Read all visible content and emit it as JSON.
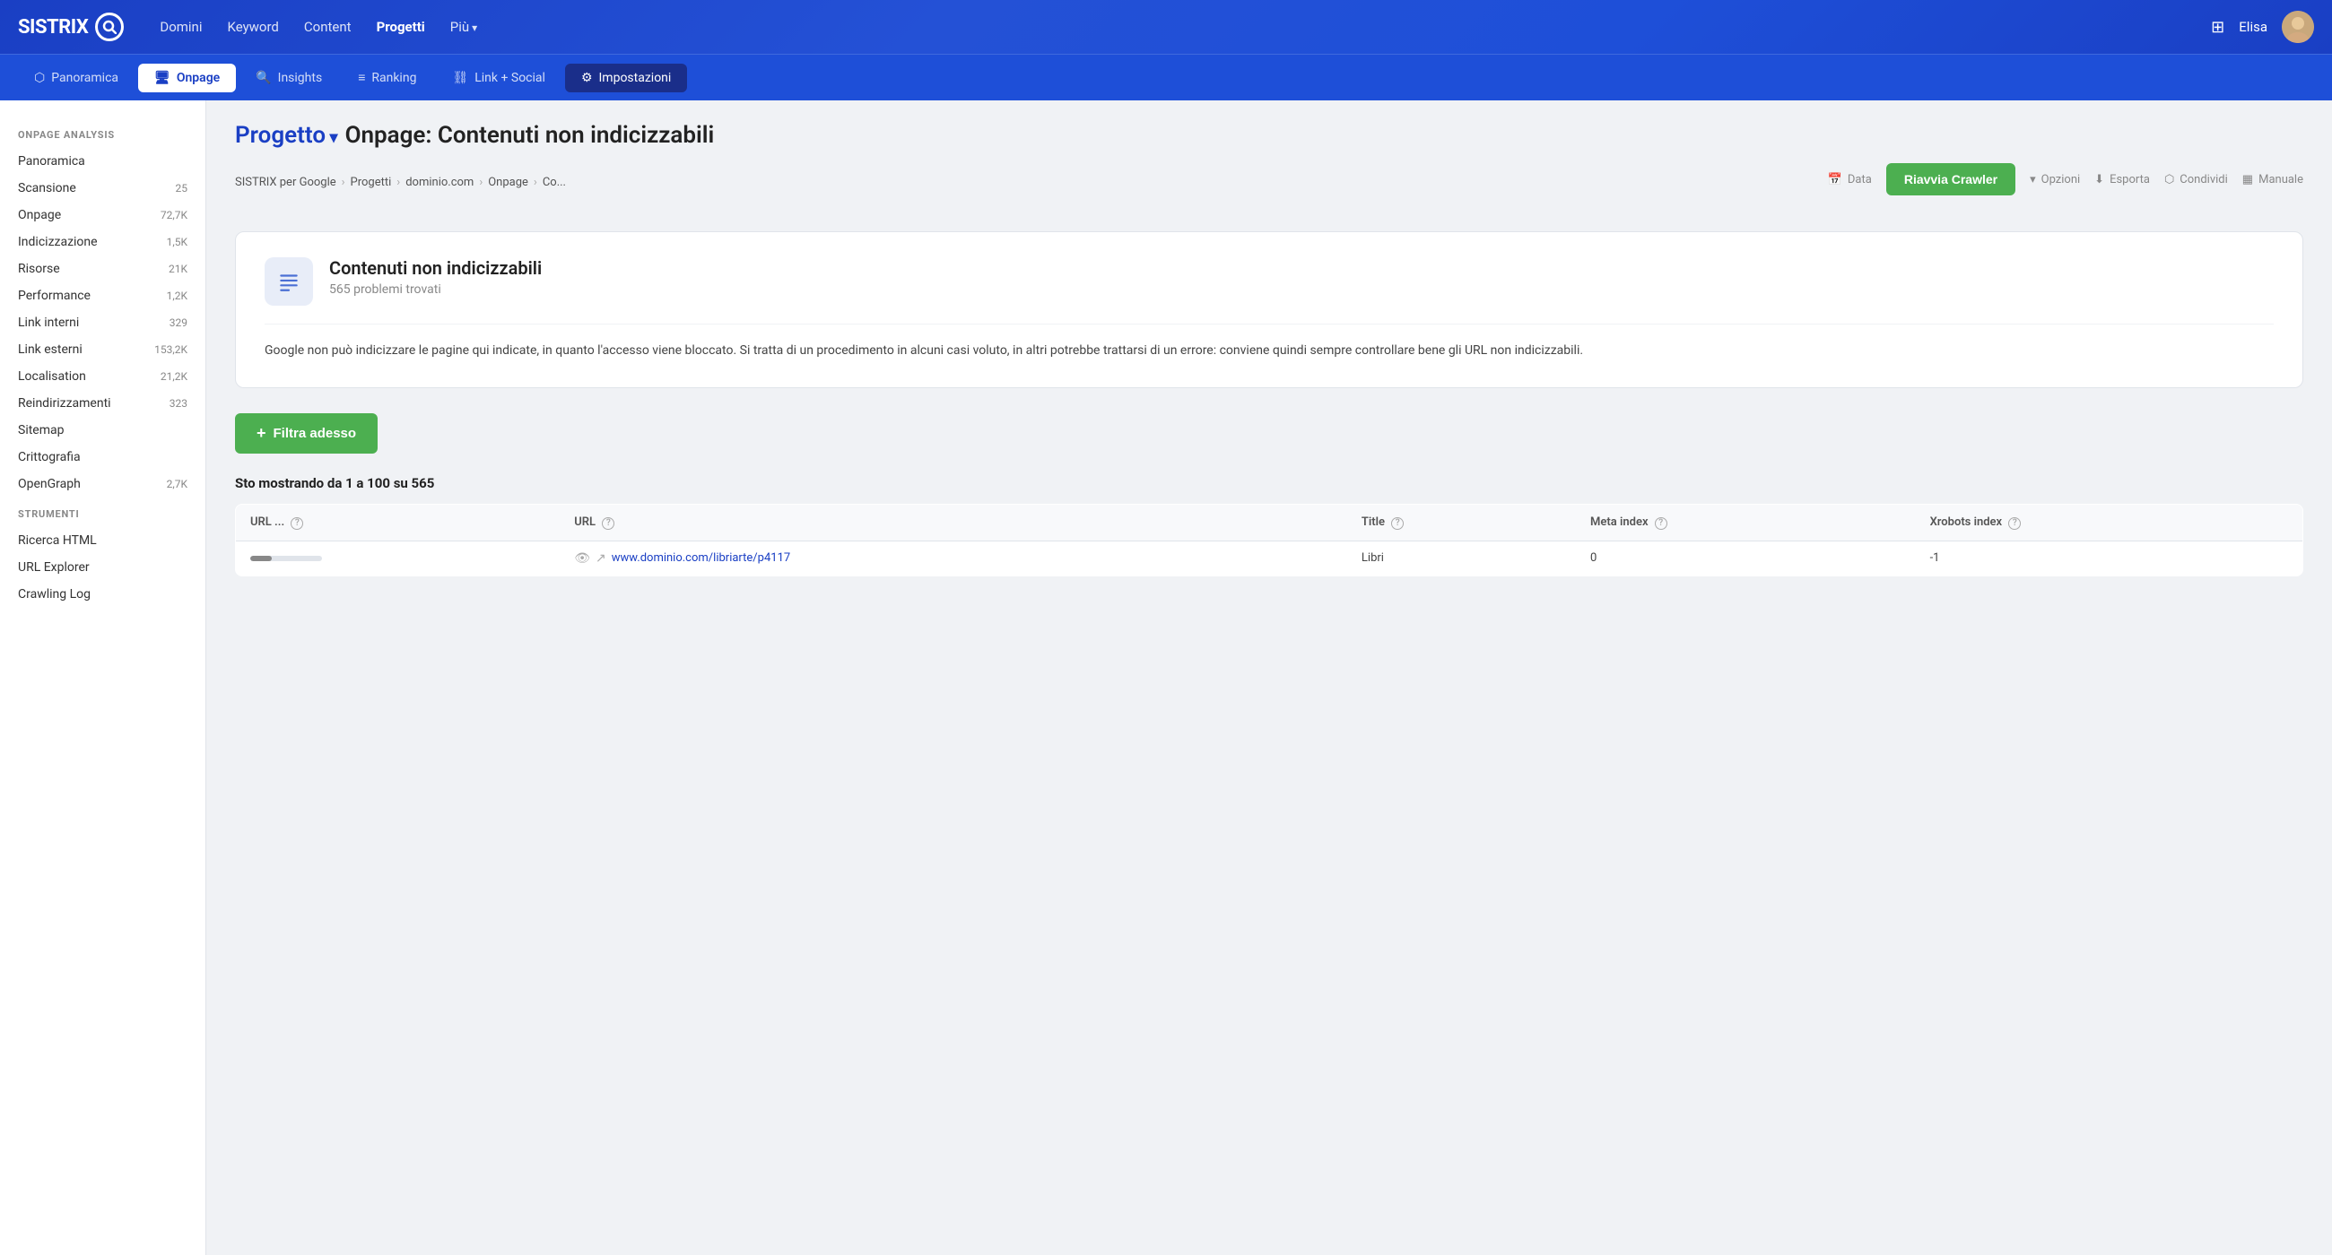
{
  "brand": {
    "name": "SISTRIX",
    "logo_letter": "S"
  },
  "top_nav": {
    "links": [
      {
        "id": "domini",
        "label": "Domini",
        "active": false,
        "has_arrow": false
      },
      {
        "id": "keyword",
        "label": "Keyword",
        "active": false,
        "has_arrow": false
      },
      {
        "id": "content",
        "label": "Content",
        "active": false,
        "has_arrow": false
      },
      {
        "id": "progetti",
        "label": "Progetti",
        "active": true,
        "has_arrow": false
      },
      {
        "id": "piu",
        "label": "Più",
        "active": false,
        "has_arrow": true
      }
    ],
    "user_name": "Elisa"
  },
  "second_nav": {
    "items": [
      {
        "id": "panoramica",
        "label": "Panoramica",
        "icon": "cube-icon",
        "active": false,
        "dark": false
      },
      {
        "id": "onpage",
        "label": "Onpage",
        "icon": "monitor-icon",
        "active": true,
        "dark": false
      },
      {
        "id": "insights",
        "label": "Insights",
        "icon": "search-icon",
        "active": false,
        "dark": false
      },
      {
        "id": "ranking",
        "label": "Ranking",
        "icon": "bars-icon",
        "active": false,
        "dark": false
      },
      {
        "id": "link-social",
        "label": "Link + Social",
        "icon": "link-icon",
        "active": false,
        "dark": false
      },
      {
        "id": "impostazioni",
        "label": "Impostazioni",
        "icon": "gear-icon",
        "active": false,
        "dark": true
      }
    ]
  },
  "sidebar": {
    "section_onpage": "ONPAGE ANALYSIS",
    "items_onpage": [
      {
        "id": "panoramica",
        "label": "Panoramica",
        "badge": ""
      },
      {
        "id": "scansione",
        "label": "Scansione",
        "badge": "25"
      },
      {
        "id": "onpage",
        "label": "Onpage",
        "badge": "72,7K"
      },
      {
        "id": "indicizzazione",
        "label": "Indicizzazione",
        "badge": "1,5K"
      },
      {
        "id": "risorse",
        "label": "Risorse",
        "badge": "21K"
      },
      {
        "id": "performance",
        "label": "Performance",
        "badge": "1,2K"
      },
      {
        "id": "link-interni",
        "label": "Link interni",
        "badge": "329"
      },
      {
        "id": "link-esterni",
        "label": "Link esterni",
        "badge": "153,2K"
      },
      {
        "id": "localisation",
        "label": "Localisation",
        "badge": "21,2K"
      },
      {
        "id": "reindirizzamenti",
        "label": "Reindirizzamenti",
        "badge": "323"
      },
      {
        "id": "sitemap",
        "label": "Sitemap",
        "badge": ""
      },
      {
        "id": "crittografia",
        "label": "Crittografia",
        "badge": ""
      },
      {
        "id": "opengraph",
        "label": "OpenGraph",
        "badge": "2,7K"
      }
    ],
    "section_strumenti": "STRUMENTI",
    "items_strumenti": [
      {
        "id": "ricerca-html",
        "label": "Ricerca HTML",
        "badge": ""
      },
      {
        "id": "url-explorer",
        "label": "URL Explorer",
        "badge": ""
      },
      {
        "id": "crawling-log",
        "label": "Crawling Log",
        "badge": ""
      }
    ]
  },
  "page": {
    "project_label": "Progetto",
    "title": "Onpage: Contenuti non indicizzabili",
    "breadcrumb": [
      "SISTRIX per Google",
      "Progetti",
      "dominio.com",
      "Onpage",
      "Co..."
    ]
  },
  "toolbar": {
    "date_label": "Data",
    "restart_crawler": "Riavvia Crawler",
    "options_label": "Opzioni",
    "export_label": "Esporta",
    "share_label": "Condividi",
    "manual_label": "Manuale"
  },
  "card": {
    "title": "Contenuti non indicizzabili",
    "subtitle": "565 problemi trovati",
    "description": "Google non può indicizzare le pagine qui indicate, in quanto l'accesso viene bloccato. Si tratta di un procedimento in alcuni casi voluto, in altri potrebbe trattarsi di un errore: conviene quindi sempre controllare bene gli URL non indicizzabili."
  },
  "filter": {
    "label": "Filtra adesso"
  },
  "table": {
    "count_text": "Sto mostrando da 1 a 100 su 565",
    "columns": [
      {
        "id": "url-bar",
        "label": "URL ..."
      },
      {
        "id": "url",
        "label": "URL"
      },
      {
        "id": "title",
        "label": "Title"
      },
      {
        "id": "meta-index",
        "label": "Meta index"
      },
      {
        "id": "xrobots-index",
        "label": "Xrobots index"
      }
    ],
    "rows": [
      {
        "url_bar_pct": 30,
        "url": "www.dominio.com/libriarte/p4117",
        "title": "Libri",
        "meta_index": "0",
        "xrobots_index": "-1"
      }
    ]
  }
}
